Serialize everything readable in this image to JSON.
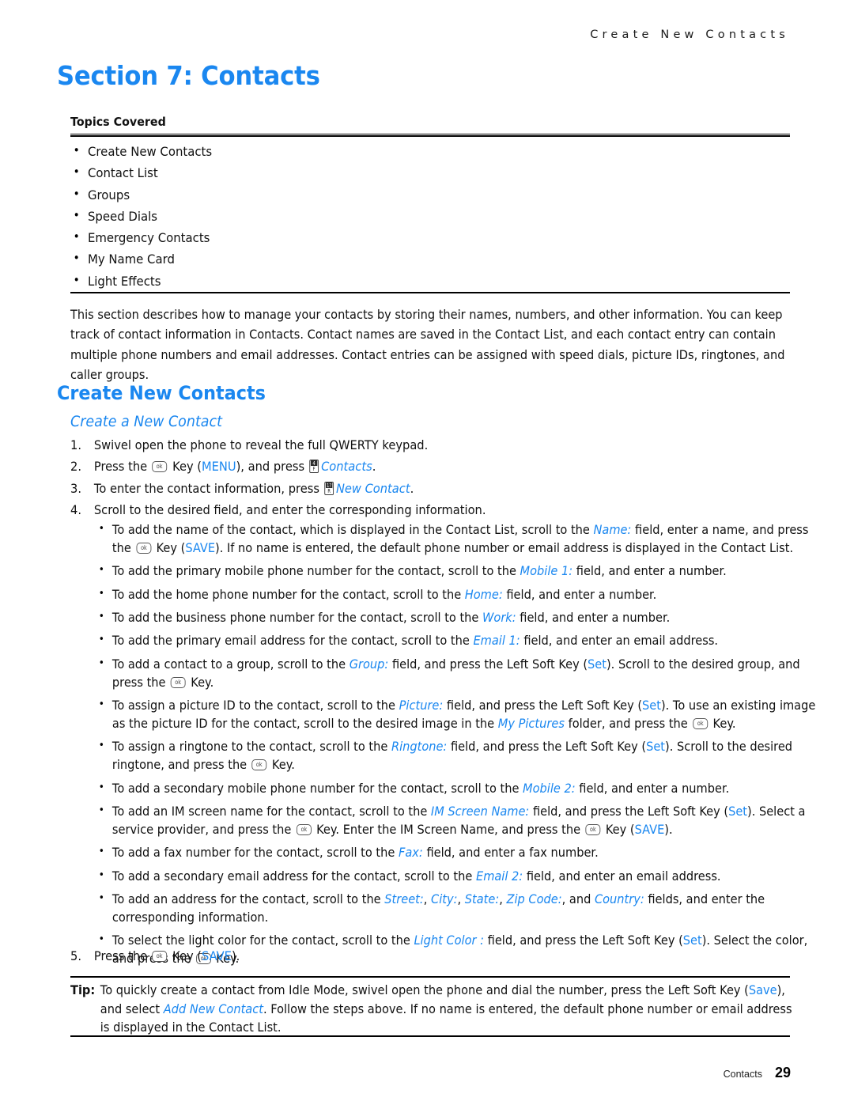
{
  "header": {
    "running_title": "Create New Contacts"
  },
  "section": {
    "title": "Section 7: Contacts"
  },
  "topics": {
    "label": "Topics Covered",
    "items": [
      "Create New Contacts",
      "Contact List",
      "Groups",
      "Speed Dials",
      "Emergency Contacts",
      "My Name Card",
      "Light Effects"
    ]
  },
  "intro": {
    "text": "This section describes how to manage your contacts by storing their names, numbers, and other information. You can keep track of contact information in Contacts. Contact names are saved in the Contact List, and each contact entry can contain multiple phone numbers and email addresses. Contact entries can be assigned with speed dials, picture IDs, ringtones, and caller groups."
  },
  "headings": {
    "h1": "Create New Contacts",
    "h2": "Create a New Contact"
  },
  "steps": [
    {
      "num": "1.",
      "parts": [
        {
          "t": "text",
          "v": "Swivel open the phone to reveal the full QWERTY keypad."
        }
      ]
    },
    {
      "num": "2.",
      "parts": [
        {
          "t": "text",
          "v": "Press the "
        },
        {
          "t": "key-ok",
          "v": "ok"
        },
        {
          "t": "text",
          "v": " Key ("
        },
        {
          "t": "blue",
          "v": "MENU"
        },
        {
          "t": "text",
          "v": "), and press "
        },
        {
          "t": "key-pad",
          "top": "4",
          "bot": "F"
        },
        {
          "t": "blue-i",
          "v": "Contacts"
        },
        {
          "t": "text",
          "v": "."
        }
      ]
    },
    {
      "num": "3.",
      "parts": [
        {
          "t": "text",
          "v": "To enter the contact information, press "
        },
        {
          "t": "key-pad",
          "top": "1?",
          "bot": "R"
        },
        {
          "t": "blue-i",
          "v": "New Contact"
        },
        {
          "t": "text",
          "v": "."
        }
      ]
    },
    {
      "num": "4.",
      "parts": [
        {
          "t": "text",
          "v": "Scroll to the desired field, and enter the corresponding information."
        }
      ]
    }
  ],
  "sub_bullets": [
    {
      "parts": [
        {
          "t": "text",
          "v": "To add the name of the contact, which is displayed in the Contact List, scroll to the "
        },
        {
          "t": "blue-i",
          "v": "Name:"
        },
        {
          "t": "text",
          "v": " field, enter a name, and press the "
        },
        {
          "t": "key-ok",
          "v": "ok"
        },
        {
          "t": "text",
          "v": " Key ("
        },
        {
          "t": "blue",
          "v": "SAVE"
        },
        {
          "t": "text",
          "v": "). If no name is entered, the default phone number or email address is displayed in the Contact List."
        }
      ]
    },
    {
      "parts": [
        {
          "t": "text",
          "v": "To add the primary mobile phone number for the contact, scroll to the "
        },
        {
          "t": "blue-i",
          "v": "Mobile 1:"
        },
        {
          "t": "text",
          "v": " field, and enter a number."
        }
      ]
    },
    {
      "parts": [
        {
          "t": "text",
          "v": "To add the home phone number for the contact, scroll to the "
        },
        {
          "t": "blue-i",
          "v": "Home:"
        },
        {
          "t": "text",
          "v": " field, and enter a number."
        }
      ]
    },
    {
      "parts": [
        {
          "t": "text",
          "v": "To add the business phone number for the contact, scroll to the "
        },
        {
          "t": "blue-i",
          "v": "Work:"
        },
        {
          "t": "text",
          "v": " field, and enter a number."
        }
      ]
    },
    {
      "parts": [
        {
          "t": "text",
          "v": "To add the primary email address for the contact, scroll to the "
        },
        {
          "t": "blue-i",
          "v": "Email 1:"
        },
        {
          "t": "text",
          "v": " field, and enter an email address."
        }
      ]
    },
    {
      "parts": [
        {
          "t": "text",
          "v": "To add a contact to a group, scroll to the "
        },
        {
          "t": "blue-i",
          "v": "Group:"
        },
        {
          "t": "text",
          "v": " field, and press the Left Soft Key ("
        },
        {
          "t": "blue",
          "v": "Set"
        },
        {
          "t": "text",
          "v": "). Scroll to the desired group, and press the "
        },
        {
          "t": "key-ok",
          "v": "ok"
        },
        {
          "t": "text",
          "v": " Key."
        }
      ]
    },
    {
      "parts": [
        {
          "t": "text",
          "v": "To assign a picture ID to the contact, scroll to the "
        },
        {
          "t": "blue-i",
          "v": "Picture:"
        },
        {
          "t": "text",
          "v": " field, and press the Left Soft Key ("
        },
        {
          "t": "blue",
          "v": "Set"
        },
        {
          "t": "text",
          "v": "). To use an existing image as the picture ID for the contact, scroll to the desired image in the "
        },
        {
          "t": "blue-i",
          "v": "My Pictures"
        },
        {
          "t": "text",
          "v": " folder, and press the "
        },
        {
          "t": "key-ok",
          "v": "ok"
        },
        {
          "t": "text",
          "v": " Key."
        }
      ]
    },
    {
      "parts": [
        {
          "t": "text",
          "v": "To assign a ringtone to the contact, scroll to the "
        },
        {
          "t": "blue-i",
          "v": "Ringtone:"
        },
        {
          "t": "text",
          "v": " field, and press the Left Soft Key ("
        },
        {
          "t": "blue",
          "v": "Set"
        },
        {
          "t": "text",
          "v": "). Scroll to the desired ringtone, and press the "
        },
        {
          "t": "key-ok",
          "v": "ok"
        },
        {
          "t": "text",
          "v": " Key."
        }
      ]
    },
    {
      "parts": [
        {
          "t": "text",
          "v": "To add a secondary mobile phone number for the contact, scroll to the "
        },
        {
          "t": "blue-i",
          "v": "Mobile 2:"
        },
        {
          "t": "text",
          "v": " field, and enter a number."
        }
      ]
    },
    {
      "parts": [
        {
          "t": "text",
          "v": "To add an IM screen name for the contact, scroll to the "
        },
        {
          "t": "blue-i",
          "v": "IM Screen Name:"
        },
        {
          "t": "text",
          "v": " field, and press the Left Soft Key ("
        },
        {
          "t": "blue",
          "v": "Set"
        },
        {
          "t": "text",
          "v": "). Select a service provider, and press the "
        },
        {
          "t": "key-ok",
          "v": "ok"
        },
        {
          "t": "text",
          "v": " Key. Enter the IM Screen Name, and press the "
        },
        {
          "t": "key-ok",
          "v": "ok"
        },
        {
          "t": "text",
          "v": " Key ("
        },
        {
          "t": "blue",
          "v": "SAVE"
        },
        {
          "t": "text",
          "v": ")."
        }
      ]
    },
    {
      "parts": [
        {
          "t": "text",
          "v": "To add a fax number for the contact, scroll to the "
        },
        {
          "t": "blue-i",
          "v": "Fax:"
        },
        {
          "t": "text",
          "v": " field, and enter a fax number."
        }
      ]
    },
    {
      "parts": [
        {
          "t": "text",
          "v": "To add a secondary email address for the contact, scroll to the "
        },
        {
          "t": "blue-i",
          "v": "Email 2:"
        },
        {
          "t": "text",
          "v": " field, and enter an email address."
        }
      ]
    },
    {
      "parts": [
        {
          "t": "text",
          "v": "To add an address for the contact, scroll to the "
        },
        {
          "t": "blue-i",
          "v": "Street:"
        },
        {
          "t": "text",
          "v": ", "
        },
        {
          "t": "blue-i",
          "v": "City:"
        },
        {
          "t": "text",
          "v": ", "
        },
        {
          "t": "blue-i",
          "v": "State:"
        },
        {
          "t": "text",
          "v": ", "
        },
        {
          "t": "blue-i",
          "v": "Zip Code:"
        },
        {
          "t": "text",
          "v": ", and "
        },
        {
          "t": "blue-i",
          "v": "Country:"
        },
        {
          "t": "text",
          "v": " fields, and enter the corresponding information."
        }
      ]
    },
    {
      "parts": [
        {
          "t": "text",
          "v": "To select the light color for the contact, scroll to the "
        },
        {
          "t": "blue-i",
          "v": "Light Color :"
        },
        {
          "t": "text",
          "v": " field, and press the Left Soft Key ("
        },
        {
          "t": "blue",
          "v": "Set"
        },
        {
          "t": "text",
          "v": "). Select the color, and press the "
        },
        {
          "t": "key-ok",
          "v": "ok"
        },
        {
          "t": "text",
          "v": " Key."
        }
      ]
    }
  ],
  "step_last": {
    "num": "5.",
    "parts": [
      {
        "t": "text",
        "v": "Press the "
      },
      {
        "t": "key-ok",
        "v": "ok"
      },
      {
        "t": "text",
        "v": " Key ("
      },
      {
        "t": "blue",
        "v": "SAVE"
      },
      {
        "t": "text",
        "v": ")."
      }
    ]
  },
  "tip": {
    "label": "Tip:",
    "parts": [
      {
        "t": "text",
        "v": "To quickly create a contact from Idle Mode, swivel open the phone and dial the number, press the Left Soft Key ("
      },
      {
        "t": "blue",
        "v": "Save"
      },
      {
        "t": "text",
        "v": "), and select "
      },
      {
        "t": "blue-i",
        "v": "Add New Contact"
      },
      {
        "t": "text",
        "v": ". Follow the steps above. If no name is entered, the default phone number or email address is displayed in the Contact List."
      }
    ]
  },
  "footer": {
    "label": "Contacts",
    "page": "29"
  },
  "colors": {
    "accent_blue": "#1a87f0",
    "text": "#111111",
    "rule": "#000000"
  }
}
